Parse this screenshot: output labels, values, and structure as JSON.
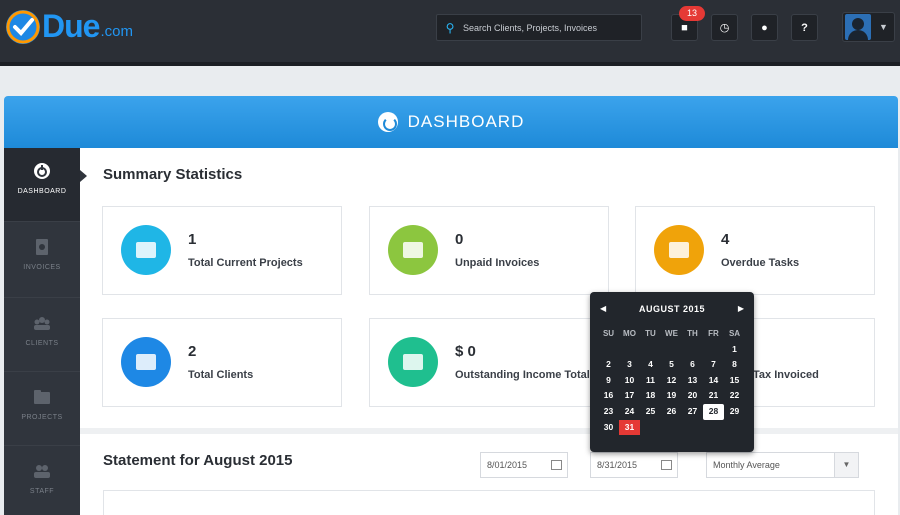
{
  "brand": {
    "name": "Due",
    "suffix": ".com"
  },
  "topbar": {
    "search_placeholder": "Search Clients, Projects, Invoices",
    "notification_count": "13"
  },
  "header": {
    "title": "DASHBOARD"
  },
  "sidebar": {
    "items": [
      {
        "label": "DASHBOARD",
        "icon": "dashboard-icon",
        "active": true
      },
      {
        "label": "INVOICES",
        "icon": "invoice-icon",
        "active": false
      },
      {
        "label": "CLIENTS",
        "icon": "clients-icon",
        "active": false
      },
      {
        "label": "PROJECTS",
        "icon": "projects-icon",
        "active": false
      },
      {
        "label": "STAFF",
        "icon": "staff-icon",
        "active": false
      }
    ]
  },
  "summary": {
    "title": "Summary Statistics",
    "cards": [
      {
        "value": "1",
        "label": "Total Current Projects",
        "color": "#1fb6e6"
      },
      {
        "value": "0",
        "label": "Unpaid Invoices",
        "color": "#8cc63f"
      },
      {
        "value": "4",
        "label": "Overdue Tasks",
        "color": "#f0a30a"
      },
      {
        "value": "2",
        "label": "Total Clients",
        "color": "#1e88e5"
      },
      {
        "value": "$ 0",
        "label": "Outstanding Income Total",
        "color": "#1fbf8f"
      },
      {
        "value": "",
        "label": "Tax Invoiced",
        "color": "#e57373"
      }
    ]
  },
  "statement": {
    "title": "Statement for August 2015",
    "start_date": "8/01/2015",
    "end_date": "8/31/2015",
    "period": "Monthly Average"
  },
  "calendar": {
    "month": "AUGUST 2015",
    "prev": "◀",
    "next": "▶",
    "weekdays": [
      "SU",
      "MO",
      "TU",
      "WE",
      "TH",
      "FR",
      "SA"
    ],
    "weeks": [
      [
        "",
        "",
        "",
        "",
        "",
        "",
        "1"
      ],
      [
        "2",
        "3",
        "4",
        "5",
        "6",
        "7",
        "8"
      ],
      [
        "9",
        "10",
        "11",
        "12",
        "13",
        "14",
        "15"
      ],
      [
        "16",
        "17",
        "18",
        "19",
        "20",
        "21",
        "22"
      ],
      [
        "23",
        "24",
        "25",
        "26",
        "27",
        "28",
        "29"
      ],
      [
        "30",
        "31",
        "",
        "",
        "",
        "",
        ""
      ]
    ],
    "today": "28",
    "selected": "31"
  },
  "colors": {
    "accent": "#1e8ad8",
    "topbar": "#2b2f36",
    "sidebar": "#30353d",
    "danger": "#e53935"
  }
}
